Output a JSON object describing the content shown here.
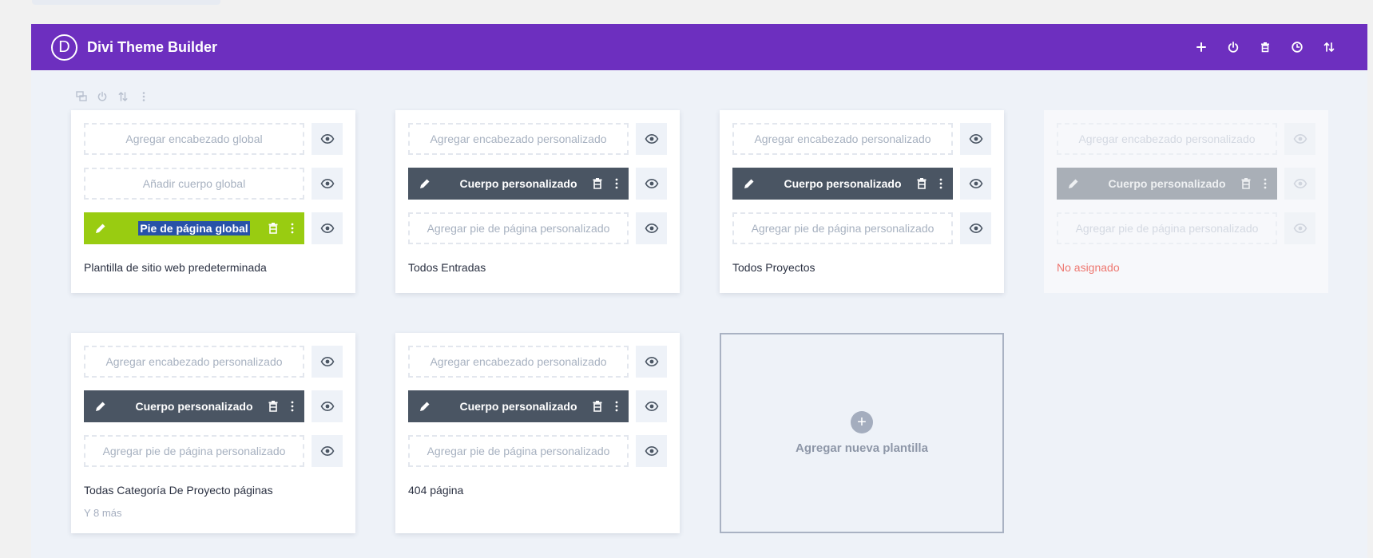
{
  "app": {
    "title": "Divi Theme Builder",
    "logo_letter": "D"
  },
  "header_actions": [
    "add-icon",
    "power-icon",
    "trash-icon",
    "history-icon",
    "sort-icon"
  ],
  "mini_toolbar": [
    "duplicate-icon",
    "power-icon",
    "sort-icon",
    "more-icon"
  ],
  "templates": [
    {
      "header": "Agregar encabezado global",
      "body": "Añadir cuerpo global",
      "footer": "Pie de página global",
      "label": "Plantilla de sitio web predeterminada"
    },
    {
      "header": "Agregar encabezado personalizado",
      "body": "Cuerpo personalizado",
      "footer": "Agregar pie de página personalizado",
      "label": "Todos Entradas"
    },
    {
      "header": "Agregar encabezado personalizado",
      "body": "Cuerpo personalizado",
      "footer": "Agregar pie de página personalizado",
      "label": "Todos Proyectos"
    },
    {
      "header": "Agregar encabezado personalizado",
      "body": "Cuerpo personalizado",
      "footer": "Agregar pie de página personalizado",
      "label": "No asignado"
    },
    {
      "header": "Agregar encabezado personalizado",
      "body": "Cuerpo personalizado",
      "footer": "Agregar pie de página personalizado",
      "label": "Todas Categoría De Proyecto páginas",
      "more": "Y 8 más"
    },
    {
      "header": "Agregar encabezado personalizado",
      "body": "Cuerpo personalizado",
      "footer": "Agregar pie de página personalizado",
      "label": "404 página"
    }
  ],
  "add_template": {
    "plus": "+",
    "label": "Agregar nueva plantilla"
  },
  "colors": {
    "header_bg": "#6d2fbf",
    "filled_slot": "#4a5563",
    "global_footer": "#99cc11",
    "unassigned": "#ee7770"
  }
}
